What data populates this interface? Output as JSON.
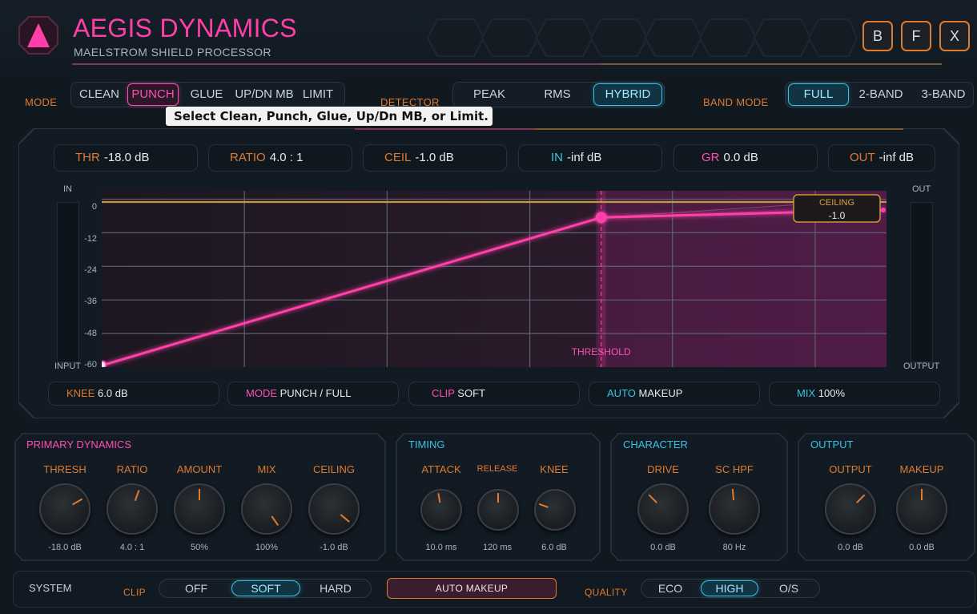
{
  "header": {
    "title": "AEGIS DYNAMICS",
    "subtitle": "MAELSTROM SHIELD PROCESSOR",
    "buttons": [
      "B",
      "F",
      "X"
    ]
  },
  "mode": {
    "label": "MODE",
    "options": [
      "CLEAN",
      "PUNCH",
      "GLUE",
      "UP/DN MB",
      "LIMIT"
    ],
    "selected": "PUNCH"
  },
  "tooltip": "Select Clean, Punch, Glue, Up/Dn MB, or Limit.",
  "detector": {
    "label": "DETECTOR",
    "options": [
      "PEAK",
      "RMS",
      "HYBRID"
    ],
    "selected": "HYBRID"
  },
  "band_mode": {
    "label": "BAND MODE",
    "options": [
      "FULL",
      "2-BAND",
      "3-BAND"
    ],
    "selected": "FULL"
  },
  "readouts": {
    "thr": {
      "key": "THR",
      "value": "-18.0 dB"
    },
    "ratio": {
      "key": "RATIO",
      "value": "4.0 : 1"
    },
    "ceil": {
      "key": "CEIL",
      "value": "-1.0 dB"
    },
    "in": {
      "key": "IN",
      "value": "-inf dB"
    },
    "gr": {
      "key": "GR",
      "value": "0.0 dB"
    },
    "out": {
      "key": "OUT",
      "value": "-inf dB"
    }
  },
  "graph": {
    "in_label": "IN",
    "out_label": "OUT",
    "input_label": "INPUT",
    "output_label": "OUTPUT",
    "y_ticks": [
      "0",
      "-12",
      "-24",
      "-36",
      "-48",
      "-60"
    ],
    "threshold_label": "THRESHOLD",
    "ceiling_label": "CEILING",
    "ceiling_value": "-1.0",
    "threshold_db": -18,
    "ceiling_db": -1,
    "ratio": 4,
    "range_db": [
      -60,
      0
    ]
  },
  "info": {
    "knee": {
      "key": "KNEE",
      "value": "6.0 dB"
    },
    "mode": {
      "key": "MODE",
      "value": "PUNCH / FULL"
    },
    "clip": {
      "key": "CLIP",
      "value": "SOFT"
    },
    "auto": {
      "key": "AUTO",
      "value": "MAKEUP"
    },
    "mix": {
      "key": "MIX",
      "value": "100%"
    }
  },
  "primary": {
    "title": "PRIMARY DYNAMICS",
    "knobs": [
      {
        "label": "THRESH",
        "value": "-18.0 dB",
        "angle": 60
      },
      {
        "label": "RATIO",
        "value": "4.0 : 1",
        "angle": 20
      },
      {
        "label": "AMOUNT",
        "value": "50%",
        "angle": 0
      },
      {
        "label": "MIX",
        "value": "100%",
        "angle": 145
      },
      {
        "label": "CEILING",
        "value": "-1.0 dB",
        "angle": 130
      }
    ]
  },
  "timing": {
    "title": "TIMING",
    "knobs": [
      {
        "label": "ATTACK",
        "value": "10.0 ms",
        "angle": -10
      },
      {
        "label": "RELEASE",
        "value": "120 ms",
        "angle": 0
      },
      {
        "label": "KNEE",
        "value": "6.0 dB",
        "angle": -70
      }
    ]
  },
  "character": {
    "title": "CHARACTER",
    "knobs": [
      {
        "label": "DRIVE",
        "value": "0.0 dB",
        "angle": -45
      },
      {
        "label": "SC HPF",
        "value": "80 Hz",
        "angle": -5
      }
    ]
  },
  "output": {
    "title": "OUTPUT",
    "knobs": [
      {
        "label": "OUTPUT",
        "value": "0.0 dB",
        "angle": 45
      },
      {
        "label": "MAKEUP",
        "value": "0.0 dB",
        "angle": 0
      }
    ]
  },
  "system": {
    "label": "SYSTEM",
    "clip_label": "CLIP",
    "clip_options": [
      "OFF",
      "SOFT",
      "HARD"
    ],
    "clip_selected": "SOFT",
    "auto_makeup": "AUTO MAKEUP",
    "quality_label": "QUALITY",
    "quality_options": [
      "ECO",
      "HIGH",
      "O/S"
    ],
    "quality_selected": "HIGH"
  },
  "colors": {
    "accent_pink": "#ff3fa8",
    "accent_cyan": "#39c3e0",
    "accent_orange": "#e07a2f",
    "ceiling_line": "#c8963c"
  }
}
